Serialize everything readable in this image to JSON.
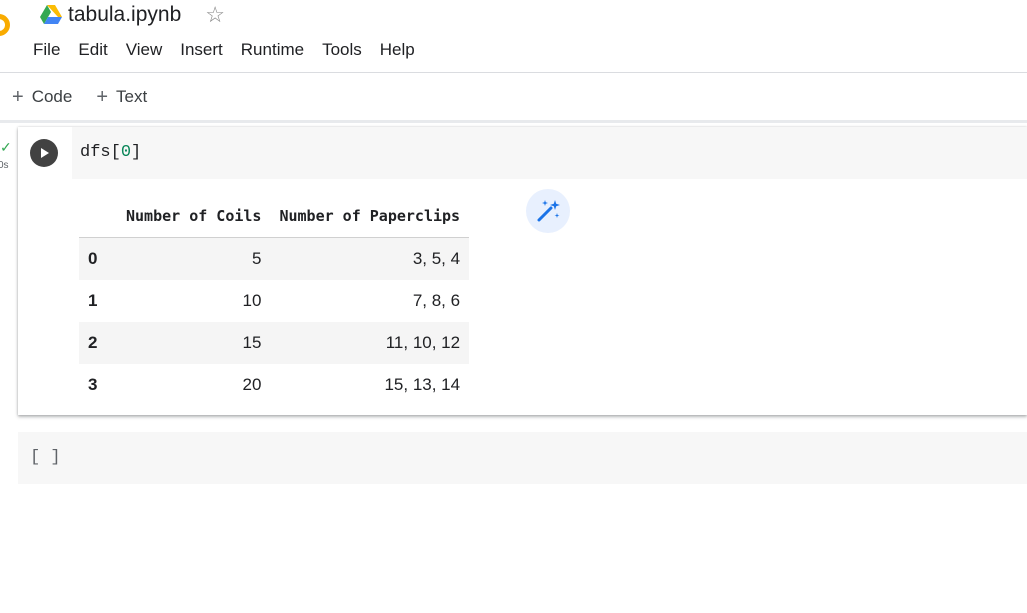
{
  "header": {
    "title": "tabula.ipynb",
    "icons": {
      "drive": "google-drive-icon",
      "star": "star-icon",
      "logo": "colab-logo"
    },
    "menu": [
      "File",
      "Edit",
      "View",
      "Insert",
      "Runtime",
      "Tools",
      "Help"
    ]
  },
  "toolbar": {
    "code_label": "Code",
    "text_label": "Text"
  },
  "cell1": {
    "status": "0s",
    "code": {
      "prefix": "dfs[",
      "index": "0",
      "suffix": "]"
    },
    "output": {
      "columns": [
        "Number of Coils",
        "Number of Paperclips"
      ],
      "rows": [
        {
          "index": "0",
          "coils": "5",
          "paperclips": "3, 5, 4"
        },
        {
          "index": "1",
          "coils": "10",
          "paperclips": "7, 8, 6"
        },
        {
          "index": "2",
          "coils": "15",
          "paperclips": "11, 10, 12"
        },
        {
          "index": "3",
          "coils": "20",
          "paperclips": "15, 13, 14"
        }
      ]
    }
  },
  "cell2": {
    "bracket": "[ ]"
  },
  "colors": {
    "accent": "#1a73e8",
    "success": "#34a853",
    "logo": "#f9ab00"
  }
}
